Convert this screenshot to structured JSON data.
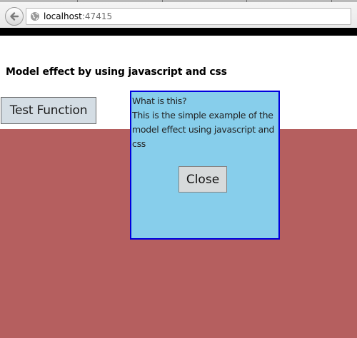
{
  "browser": {
    "url_host": "localhost",
    "url_port": ":47415",
    "back_icon": "back-arrow-icon",
    "site_icon": "globe-icon"
  },
  "page": {
    "heading": "Model effect by using javascript and css",
    "test_button_label": "Test Function",
    "overlay_color": "#b55f5f"
  },
  "modal": {
    "title": "What is this?",
    "body": "This is the simple example of the model effect using javascript and css",
    "close_label": "Close",
    "background": "#87ceeb",
    "border_color": "#0000dd"
  }
}
